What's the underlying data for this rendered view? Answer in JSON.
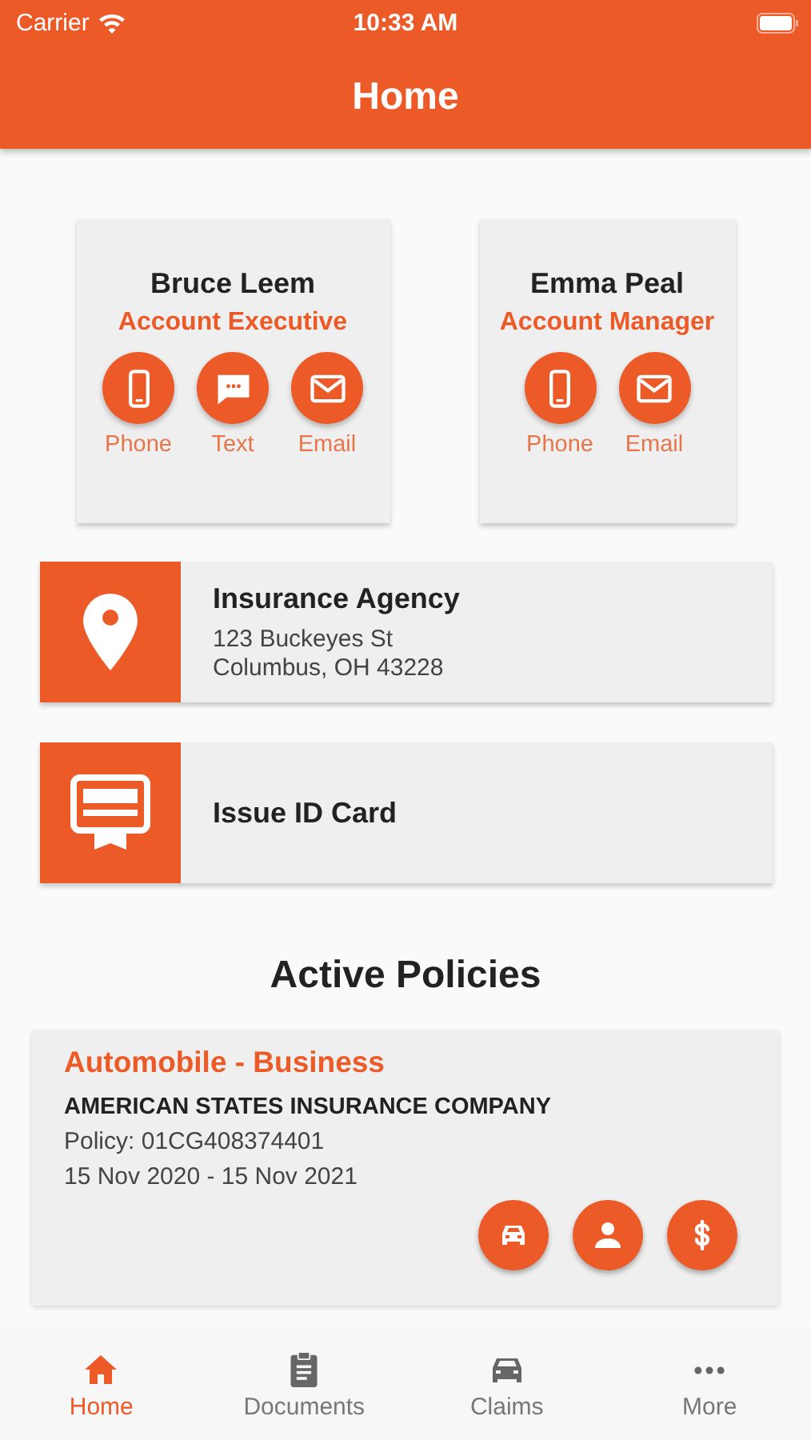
{
  "status_bar": {
    "carrier": "Carrier",
    "time": "10:33 AM"
  },
  "nav_bar": {
    "title": "Home"
  },
  "contacts": [
    {
      "name": "Bruce Leem",
      "role": "Account Executive",
      "actions": [
        {
          "kind": "phone",
          "label": "Phone"
        },
        {
          "kind": "text",
          "label": "Text"
        },
        {
          "kind": "email",
          "label": "Email"
        }
      ]
    },
    {
      "name": "Emma Peal",
      "role": "Account Manager",
      "actions": [
        {
          "kind": "phone",
          "label": "Phone"
        },
        {
          "kind": "email",
          "label": "Email"
        }
      ]
    }
  ],
  "links": [
    {
      "kind": "location",
      "title": "Insurance Agency",
      "lines": [
        "123 Buckeyes St",
        "Columbus, OH 43228"
      ]
    },
    {
      "kind": "id_card",
      "title": "Issue ID Card"
    }
  ],
  "policies_title": "Active Policies",
  "policies": [
    {
      "title": "Automobile - Business",
      "company": "AMERICAN STATES INSURANCE COMPANY",
      "policy": "Policy: 01CG408374401",
      "dates": "15 Nov 2020 - 15 Nov 2021",
      "actions": [
        {
          "kind": "car"
        },
        {
          "kind": "person"
        },
        {
          "kind": "dollar"
        }
      ]
    }
  ],
  "tabs": [
    {
      "kind": "home",
      "label": "Home",
      "selected": true
    },
    {
      "kind": "documents",
      "label": "Documents",
      "selected": false
    },
    {
      "kind": "claims",
      "label": "Claims",
      "selected": false
    },
    {
      "kind": "more",
      "label": "More",
      "selected": false
    }
  ]
}
